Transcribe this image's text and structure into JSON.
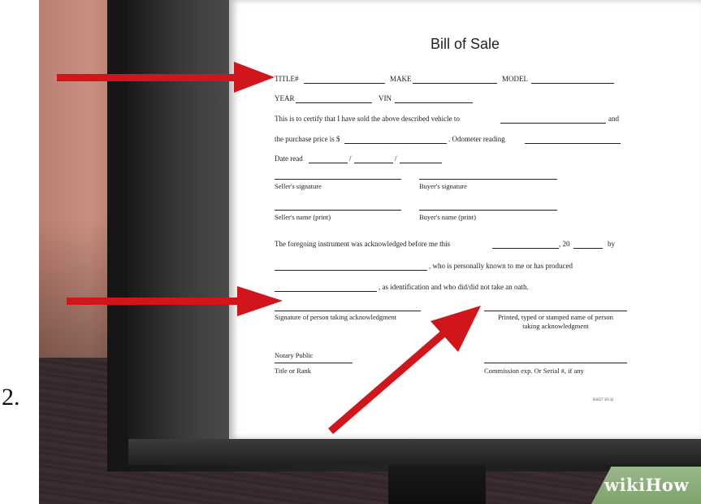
{
  "step": {
    "number": "2."
  },
  "document": {
    "title": "Bill of Sale",
    "row1": {
      "title": "TITLE#",
      "make": "MAKE",
      "model": "MODEL"
    },
    "row2": {
      "year": "YEAR",
      "vin": "VIN"
    },
    "certify": "This is to certify that I have sold the above described vehicle to",
    "certify_end": "and",
    "price": "the purchase price is $",
    "odometer": ". Odometer reading",
    "date_read": "Date read",
    "slash": "/",
    "sellers_signature": "Seller's signature",
    "buyers_signature": "Buyer's signature",
    "sellers_name": "Seller's name (print)",
    "buyers_name": "Buyer's name (print)",
    "acknowledged": "The foregoing instrument was acknowledged before me this",
    "comma_20": ", 20",
    "by": "by",
    "personally_known": ", who is personally known to me or has produced",
    "identification": ", as identification and who did/did not take an oath.",
    "sig_ack": "Signature of person taking acknowledgment",
    "printed_name_1": "Printed, typed or stamped name of person",
    "printed_name_2": "taking acknowledgment",
    "notary": "Notary Public",
    "title_rank": "Title or Rank",
    "commission": "Commission exp. Or Serial #, if any",
    "form_number": "85657 10-32"
  },
  "watermark": {
    "wiki": "wiki",
    "how": "How"
  },
  "colors": {
    "arrow": "#d0161a",
    "wall": "#c48c7c",
    "badge": "#8aad77"
  }
}
